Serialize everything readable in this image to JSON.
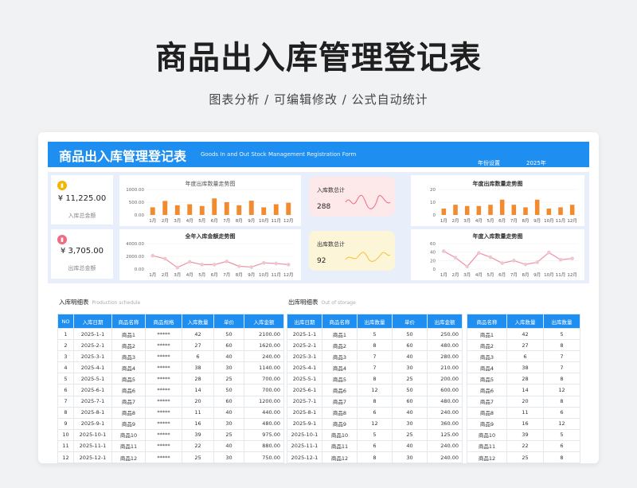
{
  "hero": {
    "title": "商品出入库管理登记表",
    "subtitle": "图表分析 /  可编辑修改  / 公式自动统计"
  },
  "banner": {
    "title": "商品出入库管理登记表",
    "subtitle_en": "Goods In and Out Stock Management Registration Form",
    "year_label": "年份设置",
    "year": "2025年"
  },
  "stats": {
    "in_total_amount": {
      "value": "¥ 11,225.00",
      "label": "入库总金额",
      "color": "#f5b400"
    },
    "out_total_amount": {
      "value": "¥ 3,705.00",
      "label": "出库总金额",
      "color": "#ef6b7f"
    }
  },
  "kpi": {
    "in_count": {
      "label": "入库数总计",
      "value": "288",
      "bg": "#fde8ea",
      "line_color": "#ef6b7f"
    },
    "out_count": {
      "label": "出库数总计",
      "value": "92",
      "bg": "#fdf5d8",
      "line_color": "#f2c230"
    }
  },
  "chart_data": [
    {
      "type": "bar",
      "title": "年度出库数量走势图",
      "categories": [
        "1月",
        "2月",
        "3月",
        "4月",
        "5月",
        "6月",
        "7月",
        "8月",
        "9月",
        "10月",
        "11月",
        "12月"
      ],
      "values": [
        300,
        550,
        380,
        420,
        350,
        650,
        500,
        380,
        560,
        300,
        420,
        480
      ],
      "ylim": [
        0,
        1000
      ],
      "yticks": [
        "1000.00",
        "500.00",
        "0.00"
      ],
      "color": "#f28a30"
    },
    {
      "type": "line",
      "title": "全年入库金额走势图",
      "categories": [
        "1月",
        "2月",
        "3月",
        "4月",
        "5月",
        "6月",
        "7月",
        "8月",
        "9月",
        "10月",
        "11月",
        "12月"
      ],
      "values": [
        2100,
        1620,
        240,
        1140,
        700,
        700,
        1200,
        440,
        320,
        975,
        880,
        700
      ],
      "ylim": [
        0,
        4000
      ],
      "yticks": [
        "4000.00",
        "2000.00",
        "0.00"
      ],
      "color": "#ef8fa0"
    },
    {
      "type": "bar",
      "title": "年度出库数量走势图",
      "categories": [
        "1月",
        "2月",
        "3月",
        "4月",
        "5月",
        "6月",
        "7月",
        "8月",
        "9月",
        "10月",
        "11月",
        "12月"
      ],
      "values": [
        5,
        8,
        7,
        7,
        8,
        12,
        8,
        6,
        12,
        5,
        6,
        8
      ],
      "ylim": [
        0,
        20
      ],
      "yticks": [
        "20",
        "10",
        "0"
      ],
      "color": "#f28a30"
    },
    {
      "type": "line",
      "title": "年度入库数量走势图",
      "categories": [
        "1月",
        "2月",
        "3月",
        "4月",
        "5月",
        "6月",
        "7月",
        "8月",
        "9月",
        "10月",
        "11月",
        "12月"
      ],
      "values": [
        42,
        27,
        6,
        38,
        28,
        14,
        20,
        11,
        16,
        39,
        22,
        25
      ],
      "ylim": [
        0,
        60
      ],
      "yticks": [
        "60",
        "40",
        "20",
        "0"
      ],
      "color": "#ef8fa0"
    }
  ],
  "in_table": {
    "title": "入库明细表",
    "title_en": "Production schedule",
    "headers": [
      "NO",
      "入库日期",
      "商品名称",
      "商品规格",
      "入库数量",
      "单价",
      "入库金额"
    ],
    "rows": [
      [
        "1",
        "2025-1-1",
        "商品1",
        "*****",
        "42",
        "50",
        "2100.00"
      ],
      [
        "2",
        "2025-2-1",
        "商品2",
        "*****",
        "27",
        "60",
        "1620.00"
      ],
      [
        "3",
        "2025-3-1",
        "商品3",
        "*****",
        "6",
        "40",
        "240.00"
      ],
      [
        "4",
        "2025-4-1",
        "商品4",
        "*****",
        "38",
        "30",
        "1140.00"
      ],
      [
        "5",
        "2025-5-1",
        "商品5",
        "*****",
        "28",
        "25",
        "700.00"
      ],
      [
        "6",
        "2025-6-1",
        "商品6",
        "*****",
        "14",
        "50",
        "700.00"
      ],
      [
        "7",
        "2025-7-1",
        "商品7",
        "*****",
        "20",
        "60",
        "1200.00"
      ],
      [
        "8",
        "2025-8-1",
        "商品8",
        "*****",
        "11",
        "40",
        "440.00"
      ],
      [
        "9",
        "2025-9-1",
        "商品9",
        "*****",
        "16",
        "30",
        "480.00"
      ],
      [
        "10",
        "2025-10-1",
        "商品10",
        "*****",
        "39",
        "25",
        "975.00"
      ],
      [
        "11",
        "2025-11-1",
        "商品11",
        "*****",
        "22",
        "40",
        "880.00"
      ],
      [
        "12",
        "2025-12-1",
        "商品12",
        "*****",
        "25",
        "30",
        "750.00"
      ]
    ]
  },
  "out_table": {
    "title": "出库明细表",
    "title_en": "Out of storage",
    "headers": [
      "出库日期",
      "商品名称",
      "出库数量",
      "单价",
      "出库金额"
    ],
    "rows": [
      [
        "2025-1-1",
        "商品1",
        "5",
        "50",
        "250.00"
      ],
      [
        "2025-2-1",
        "商品2",
        "8",
        "60",
        "480.00"
      ],
      [
        "2025-3-1",
        "商品3",
        "7",
        "40",
        "280.00"
      ],
      [
        "2025-4-1",
        "商品4",
        "7",
        "30",
        "210.00"
      ],
      [
        "2025-5-1",
        "商品5",
        "8",
        "25",
        "200.00"
      ],
      [
        "2025-6-1",
        "商品6",
        "12",
        "50",
        "600.00"
      ],
      [
        "2025-7-1",
        "商品7",
        "8",
        "60",
        "480.00"
      ],
      [
        "2025-8-1",
        "商品8",
        "6",
        "40",
        "240.00"
      ],
      [
        "2025-9-1",
        "商品9",
        "12",
        "30",
        "360.00"
      ],
      [
        "2025-10-1",
        "商品10",
        "5",
        "25",
        "125.00"
      ],
      [
        "2025-11-1",
        "商品11",
        "6",
        "40",
        "240.00"
      ],
      [
        "2025-12-1",
        "商品12",
        "8",
        "30",
        "240.00"
      ]
    ]
  },
  "summary_table": {
    "headers": [
      "商品名称",
      "入库数量",
      "出库数量"
    ],
    "rows": [
      [
        "商品1",
        "42",
        "5"
      ],
      [
        "商品2",
        "27",
        "8"
      ],
      [
        "商品3",
        "6",
        "7"
      ],
      [
        "商品4",
        "38",
        "7"
      ],
      [
        "商品5",
        "28",
        "8"
      ],
      [
        "商品6",
        "14",
        "12"
      ],
      [
        "商品7",
        "20",
        "8"
      ],
      [
        "商品8",
        "11",
        "6"
      ],
      [
        "商品9",
        "16",
        "12"
      ],
      [
        "商品10",
        "39",
        "5"
      ],
      [
        "商品11",
        "22",
        "6"
      ],
      [
        "商品12",
        "25",
        "8"
      ]
    ]
  }
}
